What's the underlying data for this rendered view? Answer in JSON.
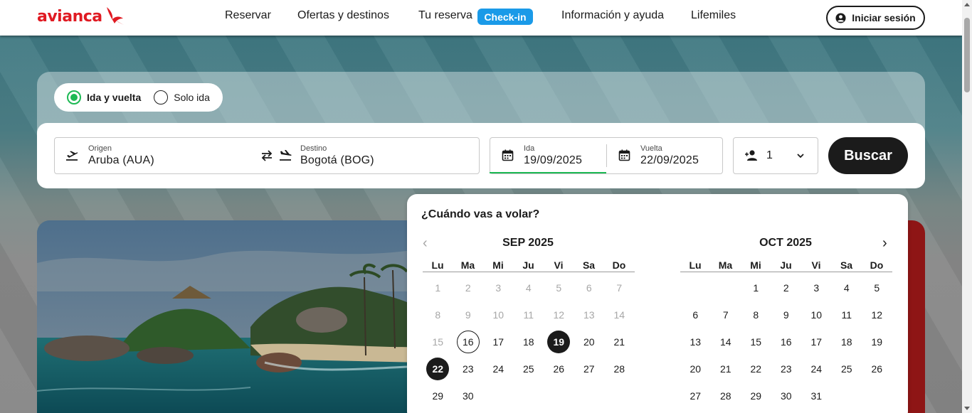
{
  "header": {
    "logo_text": "avianca",
    "nav": [
      {
        "label": "Reservar"
      },
      {
        "label": "Ofertas y destinos"
      },
      {
        "label": "Tu reserva"
      },
      {
        "label": "Información y ayuda"
      },
      {
        "label": "Lifemiles"
      }
    ],
    "checkin_label": "Check-in",
    "login_label": "Iniciar sesión"
  },
  "trip_type": {
    "options": [
      {
        "label": "Ida y vuelta",
        "selected": true
      },
      {
        "label": "Solo ida",
        "selected": false
      }
    ]
  },
  "search": {
    "origin_label": "Origen",
    "origin_value": "Aruba (AUA)",
    "destination_label": "Destino",
    "destination_value": "Bogotá (BOG)",
    "depart_label": "Ida",
    "depart_value": "19/09/2025",
    "return_label": "Vuelta",
    "return_value": "22/09/2025",
    "passengers_value": "1",
    "search_label": "Buscar"
  },
  "calendar": {
    "title": "¿Cuándo vas a volar?",
    "weekdays": [
      "Lu",
      "Ma",
      "Mi",
      "Ju",
      "Vi",
      "Sa",
      "Do"
    ],
    "months": [
      {
        "title": "SEP 2025",
        "weeks": [
          [
            {
              "d": "1",
              "muted": true
            },
            {
              "d": "2",
              "muted": true
            },
            {
              "d": "3",
              "muted": true
            },
            {
              "d": "4",
              "muted": true
            },
            {
              "d": "5",
              "muted": true
            },
            {
              "d": "6",
              "muted": true
            },
            {
              "d": "7",
              "muted": true
            }
          ],
          [
            {
              "d": "8",
              "muted": true
            },
            {
              "d": "9",
              "muted": true
            },
            {
              "d": "10",
              "muted": true
            },
            {
              "d": "11",
              "muted": true
            },
            {
              "d": "12",
              "muted": true
            },
            {
              "d": "13",
              "muted": true
            },
            {
              "d": "14",
              "muted": true
            }
          ],
          [
            {
              "d": "15",
              "muted": true
            },
            {
              "d": "16",
              "today": true
            },
            {
              "d": "17"
            },
            {
              "d": "18"
            },
            {
              "d": "19",
              "selected": true
            },
            {
              "d": "20"
            },
            {
              "d": "21"
            }
          ],
          [
            {
              "d": "22",
              "selected": true
            },
            {
              "d": "23"
            },
            {
              "d": "24"
            },
            {
              "d": "25"
            },
            {
              "d": "26"
            },
            {
              "d": "27"
            },
            {
              "d": "28"
            }
          ],
          [
            {
              "d": "29"
            },
            {
              "d": "30"
            }
          ]
        ]
      },
      {
        "title": "OCT 2025",
        "weeks": [
          [
            {
              "d": ""
            },
            {
              "d": ""
            },
            {
              "d": "1"
            },
            {
              "d": "2"
            },
            {
              "d": "3"
            },
            {
              "d": "4"
            },
            {
              "d": "5"
            }
          ],
          [
            {
              "d": "6"
            },
            {
              "d": "7"
            },
            {
              "d": "8"
            },
            {
              "d": "9"
            },
            {
              "d": "10"
            },
            {
              "d": "11"
            },
            {
              "d": "12"
            }
          ],
          [
            {
              "d": "13"
            },
            {
              "d": "14"
            },
            {
              "d": "15"
            },
            {
              "d": "16"
            },
            {
              "d": "17"
            },
            {
              "d": "18"
            },
            {
              "d": "19"
            }
          ],
          [
            {
              "d": "20"
            },
            {
              "d": "21"
            },
            {
              "d": "22"
            },
            {
              "d": "23"
            },
            {
              "d": "24"
            },
            {
              "d": "25"
            },
            {
              "d": "26"
            }
          ],
          [
            {
              "d": "27"
            },
            {
              "d": "28"
            },
            {
              "d": "29"
            },
            {
              "d": "30"
            },
            {
              "d": "31"
            }
          ]
        ]
      }
    ]
  },
  "colors": {
    "brand_red": "#e01a22",
    "accent_green": "#1db954",
    "checkin_blue": "#1a9ae8",
    "dark": "#1b1b1b"
  },
  "icons": {
    "logo": "avianca-bird-icon",
    "login": "user-circle-icon",
    "origin": "plane-takeoff-icon",
    "swap": "swap-arrows-icon",
    "destination": "plane-landing-icon",
    "date": "calendar-icon",
    "passengers": "add-person-icon",
    "dropdown": "chevron-down-icon",
    "prev_month": "chevron-left-icon",
    "next_month": "chevron-right-icon"
  }
}
